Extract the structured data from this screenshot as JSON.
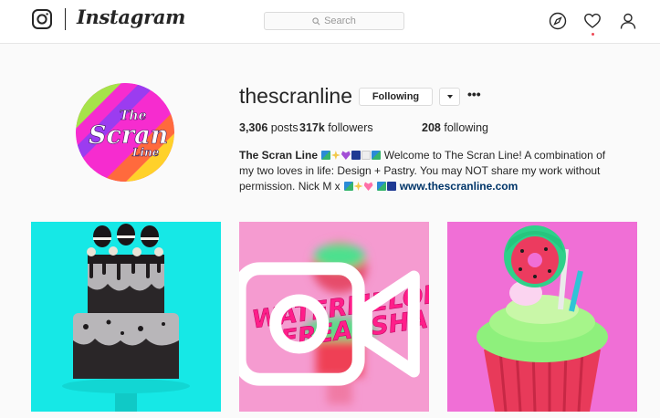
{
  "nav": {
    "brand": "Instagram",
    "search_placeholder": "Search",
    "icons": [
      "instagram-camera-icon",
      "search-icon",
      "compass-icon",
      "heart-icon",
      "user-icon"
    ]
  },
  "profile": {
    "username": "thescranline",
    "follow_label": "Following",
    "more_label": "•••",
    "stats": {
      "posts_count": "3,306",
      "posts_label": "posts",
      "followers_count": "317k",
      "followers_label": "followers",
      "following_count": "208",
      "following_label": "following"
    },
    "bio": {
      "name": "The Scran Line",
      "text_1": "Welcome to The Scran Line! A combination of my two loves in life: Design + Pastry. You may NOT share my work without permission. Nick M x",
      "link": "www.thescranline.com"
    },
    "avatar_text": [
      "The",
      "Scran",
      "Line"
    ]
  },
  "posts": [
    {
      "kind": "image",
      "subject": "oreo-drip-cake",
      "bg": "#16e8e6"
    },
    {
      "kind": "video",
      "subject": "watermelon-freakshake",
      "bg": "#f59bd0",
      "overlay_text": [
        "WATERMELON",
        "FREAKSHAKE"
      ]
    },
    {
      "kind": "image",
      "subject": "watermelon-cupcake",
      "bg": "#f06fd6"
    }
  ],
  "colors": {
    "link": "#003569",
    "notification": "#ed4956",
    "border": "#dbdbdb"
  }
}
